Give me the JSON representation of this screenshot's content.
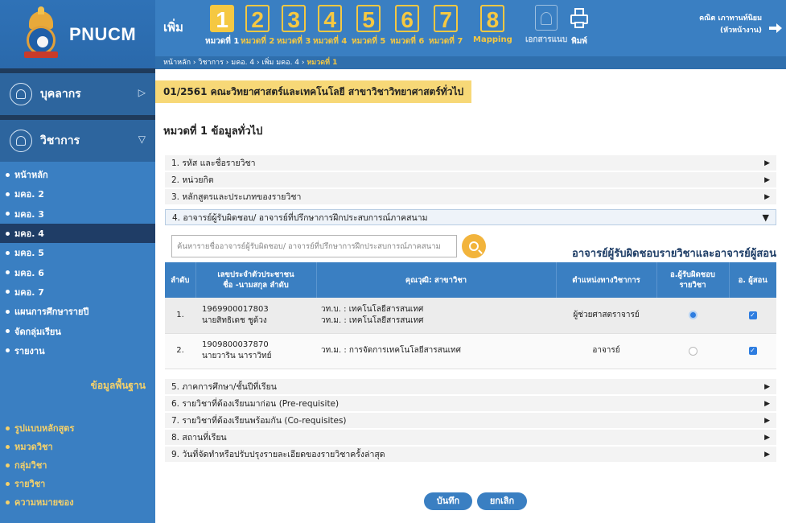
{
  "app": {
    "logo_text": "PNUCM"
  },
  "sidebar": {
    "people_section": {
      "label": "บุคลากร",
      "icon": "person-icon"
    },
    "academic_section": {
      "label": "วิชาการ",
      "icon": "document-icon"
    },
    "menu_items": [
      {
        "label": "หน้าหลัก",
        "active": false
      },
      {
        "label": "มคอ. 2",
        "active": false
      },
      {
        "label": "มคอ. 3",
        "active": false
      },
      {
        "label": "มคอ. 4",
        "active": true
      },
      {
        "label": "มคอ. 5",
        "active": false
      },
      {
        "label": "มคอ. 6",
        "active": false
      },
      {
        "label": "มคอ. 7",
        "active": false
      },
      {
        "label": "แผนการศึกษารายปี",
        "active": false
      },
      {
        "label": "จัดกลุ่มเรียน",
        "active": false
      },
      {
        "label": "รายงาน",
        "active": false
      }
    ],
    "basic_heading": "ข้อมูลพื้นฐาน",
    "basic_items": [
      {
        "label": "รูปแบบหลักสูตร"
      },
      {
        "label": "หมวดวิชา"
      },
      {
        "label": "กลุ่มวิชา"
      },
      {
        "label": "รายวิชา"
      },
      {
        "label": "ความหมายของ"
      }
    ]
  },
  "header": {
    "add_label": "เพิ่ม",
    "categories": [
      {
        "num": "1",
        "label": "หมวดที่ 1",
        "active": true
      },
      {
        "num": "2",
        "label": "หมวดที่ 2",
        "active": false
      },
      {
        "num": "3",
        "label": "หมวดที่ 3",
        "active": false
      },
      {
        "num": "4",
        "label": "หมวดที่ 4",
        "active": false
      },
      {
        "num": "5",
        "label": "หมวดที่ 5",
        "active": false
      },
      {
        "num": "6",
        "label": "หมวดที่ 6",
        "active": false
      },
      {
        "num": "7",
        "label": "หมวดที่ 7",
        "active": false
      },
      {
        "num": "8",
        "label": "Mapping",
        "active": false
      }
    ],
    "attachment_label": "เอกสารแนบ",
    "print_label": "พิมพ์",
    "user_name": "คณิต เภาทานท์นิยม",
    "user_role": "(หัวหน้างาน)",
    "breadcrumb": [
      "หน้าหลัก",
      "วิชาการ",
      "มคอ. 4",
      "เพิ่ม มคอ. 4",
      "หมวดที่ 1"
    ],
    "breadcrumb_sep": " › "
  },
  "main": {
    "program_title": "01/2561 คณะวิทยาศาสตร์และเทคโนโลยี สาขาวิชาวิทยาศาสตร์ทั่วไป",
    "section_title": "หมวดที่ 1 ข้อมูลทั่วไป",
    "accordion_top": [
      {
        "label": "1. รหัส และชื่อรายวิชา"
      },
      {
        "label": "2. หน่วยกิต"
      },
      {
        "label": "3. หลักสูตรและประเภทของรายวิชา"
      }
    ],
    "accordion_open": {
      "label": "4. อาจารย์ผู้รับผิดชอบ/ อาจารย์ที่ปรึกษาการฝึกประสบการณ์ภาคสนาม"
    },
    "search_placeholder": "ค้นหารายชื่ออาจารย์ผู้รับผิดชอบ/ อาจารย์ที่ปรึกษาการฝึกประสบการณ์ภาคสนาม",
    "teacher_heading": "อาจารย์ผู้รับผิดชอบรายวิชาและอาจารย์ผู้สอน",
    "table": {
      "headers": {
        "no": "ลำดับ",
        "id_line1": "เลขประจำตัวประชาชน",
        "id_line2": "ชื่อ -นามสกุล ลำดับ",
        "qual": "คุณวุฒิ: สาขาวิชา",
        "position": "ตำแหน่งทางวิชาการ",
        "resp_line1": "อ.ผู้รับผิดชอบ",
        "resp_line2": "รายวิชา",
        "teacher": "อ. ผู้สอน"
      },
      "rows": [
        {
          "no": "1.",
          "id": "1969900017803",
          "name": "นายสิทธิเดช ชูด้วง",
          "qual1": "วท.บ. : เทคโนโลยีสารสนเทศ",
          "qual2": "วท.ม. : เทคโนโลยีสารสนเทศ",
          "position": "ผู้ช่วยศาสตราจารย์",
          "responsible": true,
          "teacher": true
        },
        {
          "no": "2.",
          "id": "1909800037870",
          "name": "นายวาริน นาราวิทย์",
          "qual1": "วท.ม. : การจัดการเทคโนโลยีสารสนเทศ",
          "qual2": "",
          "position": "อาจารย์",
          "responsible": false,
          "teacher": true
        }
      ]
    },
    "accordion_bottom": [
      {
        "label": "5. ภาคการศึกษา/ชั้นปีที่เรียน"
      },
      {
        "label": "6. รายวิชาที่ต้องเรียนมาก่อน (Pre-requisite)"
      },
      {
        "label": "7. รายวิชาที่ต้องเรียนพร้อมกัน (Co-requisites)"
      },
      {
        "label": "8. สถานที่เรียน"
      },
      {
        "label": "9. วันที่จัดทำหรือปรับปรุงรายละเอียดของรายวิชาครั้งล่าสุด"
      }
    ],
    "save_label": "บันทึก",
    "cancel_label": "ยกเลิก"
  },
  "colors": {
    "primary": "#3a7fc2",
    "accent": "#f5c842",
    "highlight": "#f7d877",
    "active_menu": "#1f3d66"
  }
}
